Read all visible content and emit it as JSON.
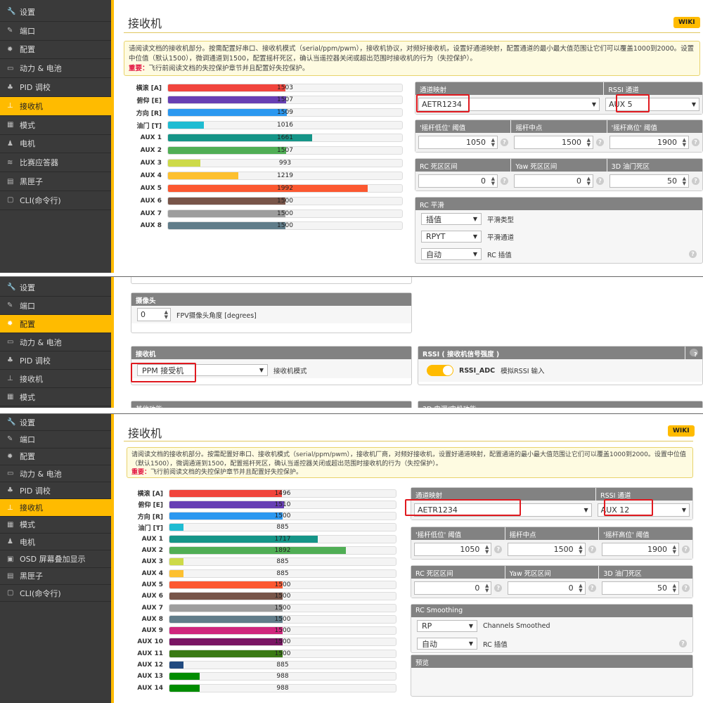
{
  "shot1": {
    "sidebar": [
      {
        "icon": "wrench-icon",
        "label": "设置"
      },
      {
        "icon": "plug-icon",
        "label": "端口"
      },
      {
        "icon": "gear-icon",
        "label": "配置"
      },
      {
        "icon": "battery-icon",
        "label": "动力 & 电池"
      },
      {
        "icon": "pid-icon",
        "label": "PID 调校"
      },
      {
        "icon": "receiver-icon",
        "label": "接收机",
        "active": true
      },
      {
        "icon": "modes-icon",
        "label": "模式"
      },
      {
        "icon": "motor-icon",
        "label": "电机"
      },
      {
        "icon": "transponder-icon",
        "label": "比赛应答器"
      },
      {
        "icon": "blackbox-icon",
        "label": "黑匣子"
      },
      {
        "icon": "cli-icon",
        "label": "CLI(命令行)"
      }
    ],
    "title": "接收机",
    "wiki": "WIKI",
    "note": {
      "text": "请阅读文档的接收机部分。按需配置好串口、接收机模式（serial/ppm/pwm），接收机协议，对频好接收机，设置好通道映射，配置通道的最小最大值范围让它们可以覆盖1000到2000。设置中位值（默认1500），微调通道到1500，配置摇杆死区，确认当遥控器关闭或超出范围时接收机的行为（失控保护）。",
      "important": "重要：",
      "important_text": "飞行前阅读文档的失控保护章节并且配置好失控保护。"
    },
    "channels": [
      {
        "label": "横滚 [A]",
        "value": 1503,
        "color": "#f1453d"
      },
      {
        "label": "俯仰 [E]",
        "value": 1507,
        "color": "#673fb4"
      },
      {
        "label": "方向 [R]",
        "value": 1509,
        "color": "#2b98f0"
      },
      {
        "label": "油门 [T]",
        "value": 1016,
        "color": "#1fbcd2"
      },
      {
        "label": "AUX 1",
        "value": 1661,
        "color": "#159588"
      },
      {
        "label": "AUX 2",
        "value": 1507,
        "color": "#50ae55"
      },
      {
        "label": "AUX 3",
        "value": 993,
        "color": "#cdda49"
      },
      {
        "label": "AUX 4",
        "value": 1219,
        "color": "#fdc02f"
      },
      {
        "label": "AUX 5",
        "value": 1992,
        "color": "#fc5830"
      },
      {
        "label": "AUX 6",
        "value": 1500,
        "color": "#785549"
      },
      {
        "label": "AUX 7",
        "value": 1500,
        "color": "#9e9e9e"
      },
      {
        "label": "AUX 8",
        "value": 1500,
        "color": "#617d8a"
      }
    ],
    "map_label": "通道映射",
    "map_value": "AETR1234",
    "rssi_label": "RSSI 通道",
    "rssi_value": "AUX 5",
    "stick_headers": [
      "'摇杆低位' 阈值",
      "摇杆中点",
      "'摇杆高位' 阈值"
    ],
    "stick_values": [
      "1050",
      "1500",
      "1900"
    ],
    "dead_headers": [
      "RC 死区区间",
      "Yaw 死区区间",
      "3D 油门死区"
    ],
    "dead_values": [
      "0",
      "0",
      "50"
    ],
    "smooth_title": "RC 平滑",
    "smooth_rows": [
      {
        "value": "插值",
        "label": "平滑类型"
      },
      {
        "value": "RPYT",
        "label": "平滑通道"
      },
      {
        "value": "自动",
        "label": "RC 插值"
      }
    ]
  },
  "shot2": {
    "sidebar": [
      {
        "icon": "wrench-icon",
        "label": "设置"
      },
      {
        "icon": "plug-icon",
        "label": "端口"
      },
      {
        "icon": "gear-icon",
        "label": "配置",
        "active": true
      },
      {
        "icon": "battery-icon",
        "label": "动力 & 电池"
      },
      {
        "icon": "pid-icon",
        "label": "PID 调校"
      },
      {
        "icon": "receiver-icon",
        "label": "接收机"
      },
      {
        "icon": "modes-icon",
        "label": "模式"
      }
    ],
    "camera_title": "摄像头",
    "camera_value": "0",
    "camera_label": "FPV摄像头角度 [degrees]",
    "receiver_title": "接收机",
    "receiver_value": "PPM 接受机",
    "receiver_label": "接收机模式",
    "rssi_title": "RSSI ( 接收机信号强度 )",
    "rssi_toggle": "RSSI_ADC",
    "rssi_toggle_desc": "模拟RSSI 输入",
    "rssi_on": true,
    "cut1": "其他功能",
    "cut2": "3D 电调/电机功能"
  },
  "shot3": {
    "sidebar": [
      {
        "icon": "wrench-icon",
        "label": "设置"
      },
      {
        "icon": "plug-icon",
        "label": "端口"
      },
      {
        "icon": "gear-icon",
        "label": "配置"
      },
      {
        "icon": "battery-icon",
        "label": "动力 & 电池"
      },
      {
        "icon": "pid-icon",
        "label": "PID 调校"
      },
      {
        "icon": "receiver-icon",
        "label": "接收机",
        "active": true
      },
      {
        "icon": "modes-icon",
        "label": "模式"
      },
      {
        "icon": "motor-icon",
        "label": "电机"
      },
      {
        "icon": "osd-icon",
        "label": "OSD 屏幕叠加显示"
      },
      {
        "icon": "blackbox-icon",
        "label": "黑匣子"
      },
      {
        "icon": "cli-icon",
        "label": "CLI(命令行)"
      }
    ],
    "title": "接收机",
    "wiki": "WIKI",
    "note": {
      "text": "请阅读文档的接收机部分。按需配置好串口、接收机模式（serial/ppm/pwm），接收机厂商，对频好接收机，设置好通道映射，配置通道的最小最大值范围让它们可以覆盖1000到2000。设置中位值（默认1500），微调通道到1500，配置摇杆死区，确认当遥控器关闭或超出范围时接收机的行为（失控保护）。",
      "important": "重要：",
      "important_text": "飞行前阅读文档的失控保护章节并且配置好失控保护。"
    },
    "channels": [
      {
        "label": "横滚 [A]",
        "value": 1496,
        "color": "#f1453d"
      },
      {
        "label": "俯仰 [E]",
        "value": 1510,
        "color": "#673fb4"
      },
      {
        "label": "方向 [R]",
        "value": 1500,
        "color": "#2b98f0"
      },
      {
        "label": "油门 [T]",
        "value": 885,
        "color": "#1fbcd2"
      },
      {
        "label": "AUX 1",
        "value": 1717,
        "color": "#159588"
      },
      {
        "label": "AUX 2",
        "value": 1892,
        "color": "#50ae55"
      },
      {
        "label": "AUX 3",
        "value": 885,
        "color": "#cdda49"
      },
      {
        "label": "AUX 4",
        "value": 885,
        "color": "#fdc02f"
      },
      {
        "label": "AUX 5",
        "value": 1500,
        "color": "#fc5830"
      },
      {
        "label": "AUX 6",
        "value": 1500,
        "color": "#785549"
      },
      {
        "label": "AUX 7",
        "value": 1500,
        "color": "#9e9e9e"
      },
      {
        "label": "AUX 8",
        "value": 1500,
        "color": "#617d8a"
      },
      {
        "label": "AUX 9",
        "value": 1500,
        "color": "#cf267d"
      },
      {
        "label": "AUX 10",
        "value": 1500,
        "color": "#7a1464"
      },
      {
        "label": "AUX 11",
        "value": 1500,
        "color": "#3a7a14"
      },
      {
        "label": "AUX 12",
        "value": 885,
        "color": "#214a80"
      },
      {
        "label": "AUX 13",
        "value": 988,
        "color": "#008c00"
      },
      {
        "label": "AUX 14",
        "value": 988,
        "color": "#008c00"
      }
    ],
    "map_label": "通道映射",
    "map_value": "AETR1234",
    "rssi_label": "RSSI 通道",
    "rssi_value": "AUX 12",
    "stick_headers": [
      "'摇杆低位' 阈值",
      "摇杆中点",
      "'摇杆高位' 阈值"
    ],
    "stick_values": [
      "1050",
      "1500",
      "1900"
    ],
    "dead_headers": [
      "RC 死区区间",
      "Yaw 死区区间",
      "3D 油门死区"
    ],
    "dead_values": [
      "0",
      "0",
      "50"
    ],
    "smooth_title": "RC Smoothing",
    "smooth_rows": [
      {
        "value": "RP",
        "label": "Channels Smoothed"
      },
      {
        "value": "自动",
        "label": "RC 插值"
      }
    ],
    "preview_title": "预览"
  }
}
